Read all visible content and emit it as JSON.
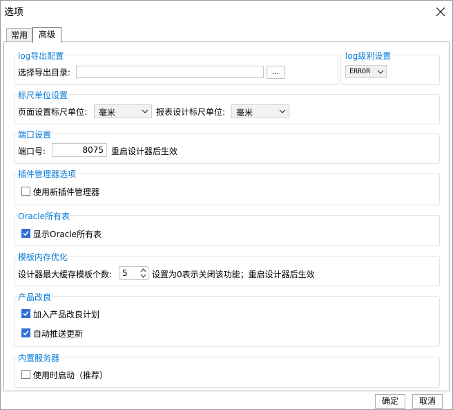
{
  "window": {
    "title": "选项"
  },
  "tabs": [
    {
      "label": "常用"
    },
    {
      "label": "高级"
    }
  ],
  "log_export": {
    "title": "log导出配置",
    "dir_label": "选择导出目录:",
    "dir_value": "",
    "browse_label": "..."
  },
  "log_level": {
    "title": "log级别设置",
    "value": "ERROR"
  },
  "ruler": {
    "title": "标尺单位设置",
    "page_label": "页面设置标尺单位:",
    "page_value": "毫米",
    "report_label": "报表设计标尺单位:",
    "report_value": "毫米"
  },
  "port": {
    "title": "端口设置",
    "label": "端口号:",
    "value": "8075",
    "hint": "重启设计器后生效"
  },
  "plugin": {
    "title": "插件管理器选项",
    "checkbox_label": "使用新插件管理器",
    "checked": false
  },
  "oracle": {
    "title": "Oracle所有表",
    "checkbox_label": "显示Oracle所有表",
    "checked": true
  },
  "template_mem": {
    "title": "模板内存优化",
    "label": "设计器最大缓存模板个数:",
    "value": "5",
    "hint": "设置为0表示关闭该功能；重启设计器后生效"
  },
  "product": {
    "title": "产品改良",
    "items": [
      {
        "label": "加入产品改良计划",
        "checked": true
      },
      {
        "label": "自动推送更新",
        "checked": true
      }
    ]
  },
  "server": {
    "title": "内置服务器",
    "checkbox_label": "使用时启动（推荐）",
    "checked": false
  },
  "footer": {
    "ok": "确定",
    "cancel": "取消"
  }
}
